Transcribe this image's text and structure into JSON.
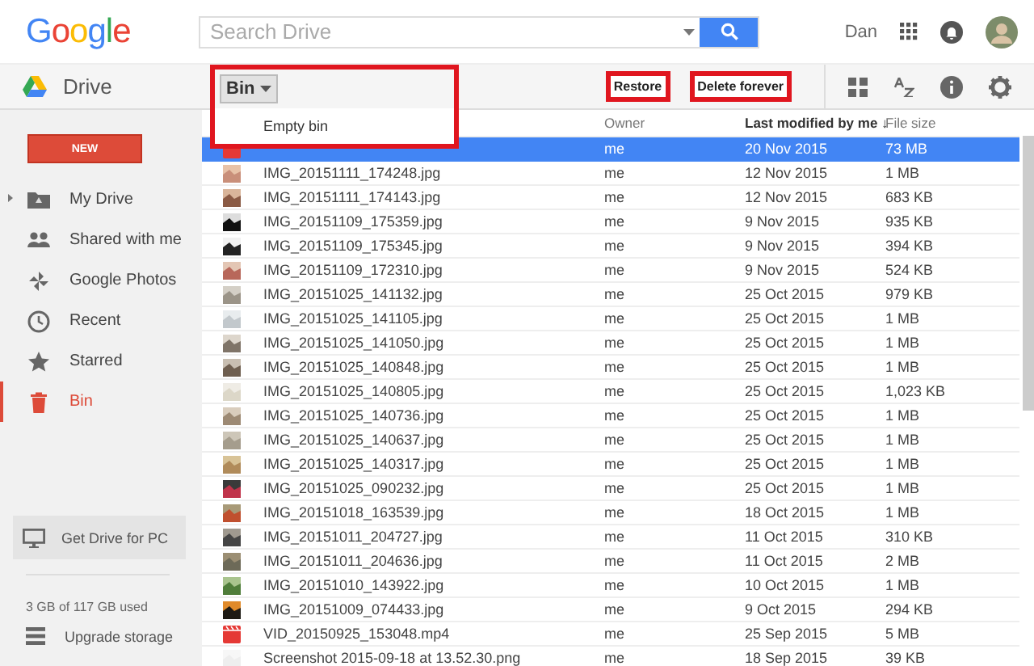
{
  "header": {
    "logo": "Google",
    "search": {
      "placeholder": "Search Drive"
    },
    "user": "Dan"
  },
  "toolbar": {
    "app_name": "Drive",
    "folder_menu": {
      "label": "Bin",
      "highlighted": true,
      "expanded": true,
      "items": [
        "Empty bin"
      ]
    },
    "actions": [
      {
        "label": "Restore",
        "highlighted": true
      },
      {
        "label": "Delete forever",
        "highlighted": true
      }
    ]
  },
  "sidebar": {
    "new_button": "NEW",
    "items": [
      {
        "label": "My Drive",
        "kind": "drive",
        "selected": false
      },
      {
        "label": "Shared with me",
        "kind": "people",
        "selected": false
      },
      {
        "label": "Google Photos",
        "kind": "photos",
        "selected": false
      },
      {
        "label": "Recent",
        "kind": "clock",
        "selected": false
      },
      {
        "label": "Starred",
        "kind": "star",
        "selected": false
      },
      {
        "label": "Bin",
        "kind": "bin",
        "selected": true
      }
    ],
    "get_drive": "Get Drive for PC",
    "storage": "3 GB of 117 GB used",
    "upgrade": "Upgrade storage"
  },
  "table": {
    "columns": [
      "Owner",
      "Last modified by me ↓",
      "File size"
    ],
    "rows": [
      {
        "kind": "video",
        "owner": "me",
        "modified": "20 Nov 2015",
        "size": "73 MB",
        "selected": true
      },
      {
        "name": "IMG_20151111_174248.jpg",
        "owner": "me",
        "modified": "12 Nov 2015",
        "size": "1 MB",
        "selected": false
      },
      {
        "name": "IMG_20151111_174143.jpg",
        "owner": "me",
        "modified": "12 Nov 2015",
        "size": "683 KB",
        "selected": false
      },
      {
        "name": "IMG_20151109_175359.jpg",
        "owner": "me",
        "modified": "9 Nov 2015",
        "size": "935 KB",
        "selected": false
      },
      {
        "name": "IMG_20151109_175345.jpg",
        "owner": "me",
        "modified": "9 Nov 2015",
        "size": "394 KB",
        "selected": false
      },
      {
        "name": "IMG_20151109_172310.jpg",
        "owner": "me",
        "modified": "9 Nov 2015",
        "size": "524 KB",
        "selected": false
      },
      {
        "name": "IMG_20151025_141132.jpg",
        "owner": "me",
        "modified": "25 Oct 2015",
        "size": "979 KB",
        "selected": false
      },
      {
        "name": "IMG_20151025_141105.jpg",
        "owner": "me",
        "modified": "25 Oct 2015",
        "size": "1 MB",
        "selected": false
      },
      {
        "name": "IMG_20151025_141050.jpg",
        "owner": "me",
        "modified": "25 Oct 2015",
        "size": "1 MB",
        "selected": false
      },
      {
        "name": "IMG_20151025_140848.jpg",
        "owner": "me",
        "modified": "25 Oct 2015",
        "size": "1 MB",
        "selected": false
      },
      {
        "name": "IMG_20151025_140805.jpg",
        "owner": "me",
        "modified": "25 Oct 2015",
        "size": "1,023 KB",
        "selected": false
      },
      {
        "name": "IMG_20151025_140736.jpg",
        "owner": "me",
        "modified": "25 Oct 2015",
        "size": "1 MB",
        "selected": false
      },
      {
        "name": "IMG_20151025_140637.jpg",
        "owner": "me",
        "modified": "25 Oct 2015",
        "size": "1 MB",
        "selected": false
      },
      {
        "name": "IMG_20151025_140317.jpg",
        "owner": "me",
        "modified": "25 Oct 2015",
        "size": "1 MB",
        "selected": false
      },
      {
        "name": "IMG_20151025_090232.jpg",
        "owner": "me",
        "modified": "25 Oct 2015",
        "size": "1 MB",
        "selected": false
      },
      {
        "name": "IMG_20151018_163539.jpg",
        "owner": "me",
        "modified": "18 Oct 2015",
        "size": "1 MB",
        "selected": false
      },
      {
        "name": "IMG_20151011_204727.jpg",
        "owner": "me",
        "modified": "11 Oct 2015",
        "size": "310 KB",
        "selected": false
      },
      {
        "name": "IMG_20151011_204636.jpg",
        "owner": "me",
        "modified": "11 Oct 2015",
        "size": "2 MB",
        "selected": false
      },
      {
        "name": "IMG_20151010_143922.jpg",
        "owner": "me",
        "modified": "10 Oct 2015",
        "size": "1 MB",
        "selected": false
      },
      {
        "name": "IMG_20151009_074433.jpg",
        "owner": "me",
        "modified": "9 Oct 2015",
        "size": "294 KB",
        "selected": false
      },
      {
        "kind": "video",
        "name": "VID_20150925_153048.mp4",
        "owner": "me",
        "modified": "25 Sep 2015",
        "size": "5 MB",
        "selected": false
      },
      {
        "name": "Screenshot 2015-09-18 at 13.52.30.png",
        "owner": "me",
        "modified": "18 Sep 2015",
        "size": "39 KB",
        "selected": false
      }
    ]
  }
}
